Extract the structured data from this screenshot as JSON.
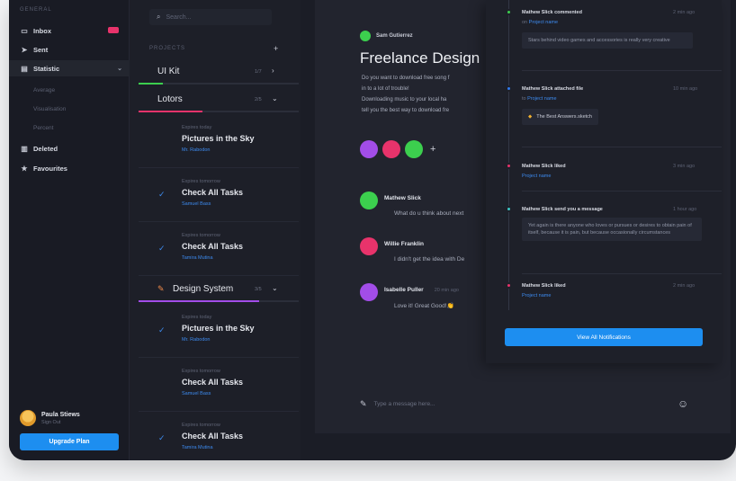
{
  "sidebar": {
    "section": "GENERAL",
    "items": [
      {
        "icon": "inbox-icon",
        "glyph": "▭",
        "label": "Inbox"
      },
      {
        "icon": "send-icon",
        "glyph": "➤",
        "label": "Sent"
      },
      {
        "icon": "chart-icon",
        "glyph": "▤",
        "label": "Statistic"
      }
    ],
    "subitems": [
      "Average",
      "Visualisation",
      "Percent"
    ],
    "items2": [
      {
        "icon": "trash-icon",
        "glyph": "🗑",
        "label": "Deleted"
      },
      {
        "icon": "star-icon",
        "glyph": "★",
        "label": "Favourites"
      }
    ],
    "profile": {
      "name": "Paula Stiews",
      "sub": "Sign Out"
    },
    "upgrade": "Upgrade Plan"
  },
  "tasks": {
    "search_placeholder": "Search...",
    "projects_header": "PROJECTS",
    "projects": [
      {
        "name": "UI Kit",
        "count": "1/7",
        "progress": 0.15,
        "color": "#3ccf4e"
      },
      {
        "name": "Lotors",
        "count": "2/5",
        "progress": 0.4,
        "color": "#e8336b"
      },
      {
        "name": "Design System",
        "count": "3/5",
        "progress": 0.75,
        "color": "#a24de8"
      }
    ],
    "lotors_tasks": [
      {
        "due": "Expires today",
        "title": "Pictures in the Sky",
        "who": "Mr. Rabodon",
        "checked": false
      },
      {
        "due": "Expires tomorrow",
        "title": "Check All Tasks",
        "who": "Samuel Bass",
        "checked": true
      },
      {
        "due": "Expires tomorrow",
        "title": "Check All Tasks",
        "who": "Tamira Mutina",
        "checked": true
      }
    ],
    "ds_tasks": [
      {
        "due": "Expires today",
        "title": "Pictures in the Sky",
        "who": "Mr. Rabodon",
        "checked": true
      },
      {
        "due": "Expires tomorrow",
        "title": "Check All Tasks",
        "who": "Samuel Bass",
        "checked": false
      },
      {
        "due": "Expires tomorrow",
        "title": "Check All Tasks",
        "who": "Tamira Mutina",
        "checked": true
      }
    ]
  },
  "main": {
    "author": "Sam Gutierrez",
    "title": "Freelance Design",
    "paragraph": [
      "Do you want to download free song f",
      "in to a lot of trouble!",
      "Downloading music to your local ha",
      "tell you the best way to download fre"
    ],
    "messages": [
      {
        "name": "Mathew Slick",
        "text": "What do u think about next",
        "time": "",
        "color": "#3ccf4e"
      },
      {
        "name": "Willie Franklin",
        "text": "I didn't get the idea with De",
        "time": "",
        "color": "#e8336b"
      },
      {
        "name": "Isabelle Puller",
        "text": "Love it! Great Good!👏",
        "time": "20 min ago",
        "color": "#a24de8"
      }
    ],
    "composer_placeholder": "Type a message here..."
  },
  "notifications": {
    "items": [
      {
        "title": "Mathew Slick commented",
        "time": "2 min ago",
        "sub_prefix": "on ",
        "sub_link": "Project name",
        "body": "Stars behind video games and accessories is really very creative",
        "color": "#3ccf4e"
      },
      {
        "title": "Mathew Slick attached file",
        "time": "10 min ago",
        "sub_prefix": "to ",
        "sub_link": "Project name",
        "file": "The Best Answers.sketch",
        "color": "#2f7bf0"
      },
      {
        "title": "Mathew Slick liked",
        "time": "3 min ago",
        "sub_prefix": "",
        "sub_link": "Project name",
        "color": "#e8336b"
      },
      {
        "title": "Mathew Slick send you a message",
        "time": "1 hour ago",
        "body": "Yet again is there anyone who loves or pursues or desires to obtain pain of itself, because it is pain, but because occasionally circumstances",
        "color": "#3cc6c6"
      },
      {
        "title": "Mathew Slick liked",
        "time": "2 min ago",
        "sub_prefix": "",
        "sub_link": "Project name",
        "color": "#e8336b"
      }
    ],
    "view_all": "View All Notifications"
  }
}
